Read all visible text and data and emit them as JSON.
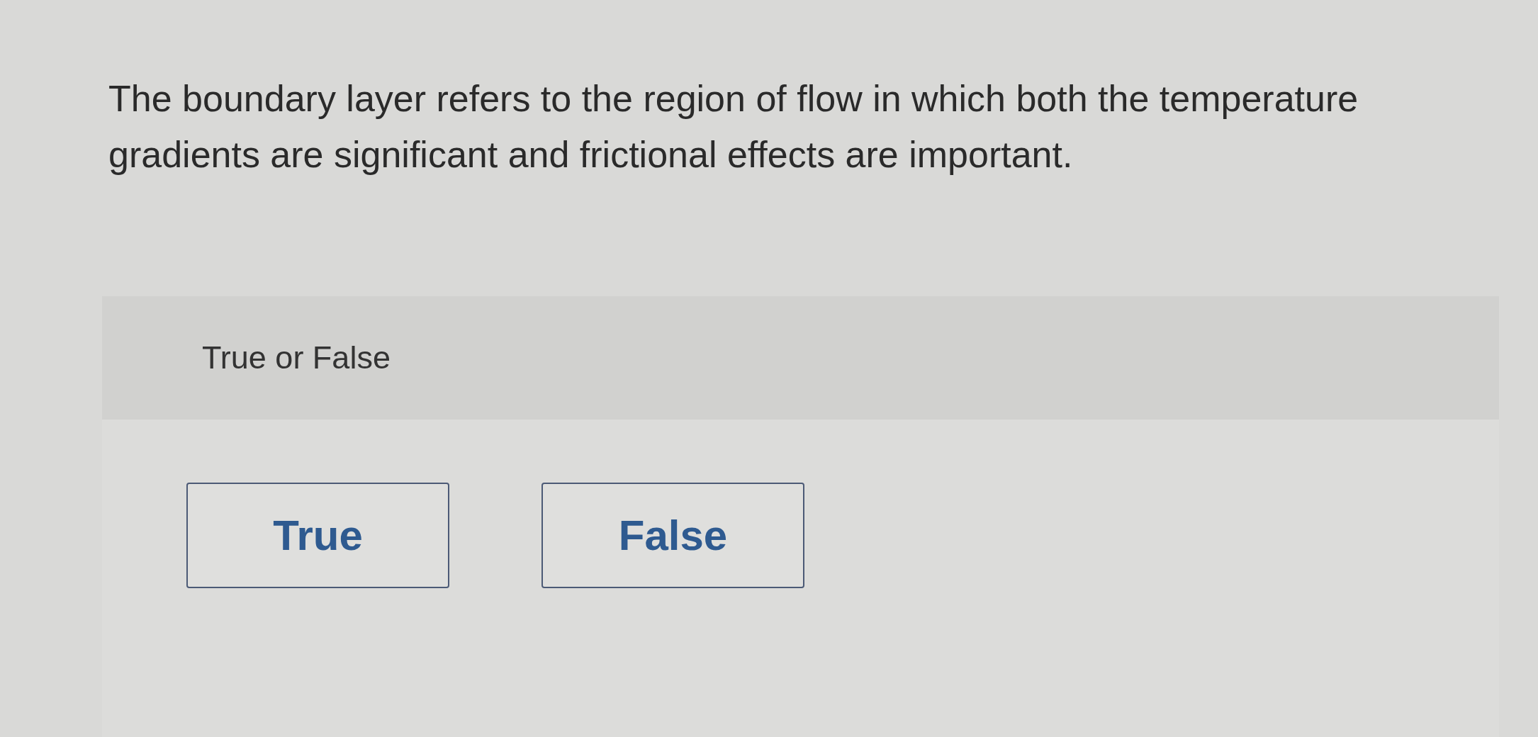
{
  "question": {
    "text": "The boundary layer refers to the region of flow in which both the temperature gradients are significant and frictional effects are important."
  },
  "answer_panel": {
    "prompt": "True or False",
    "options": [
      {
        "label": "True",
        "selected": false
      },
      {
        "label": "False",
        "selected": false
      }
    ]
  }
}
